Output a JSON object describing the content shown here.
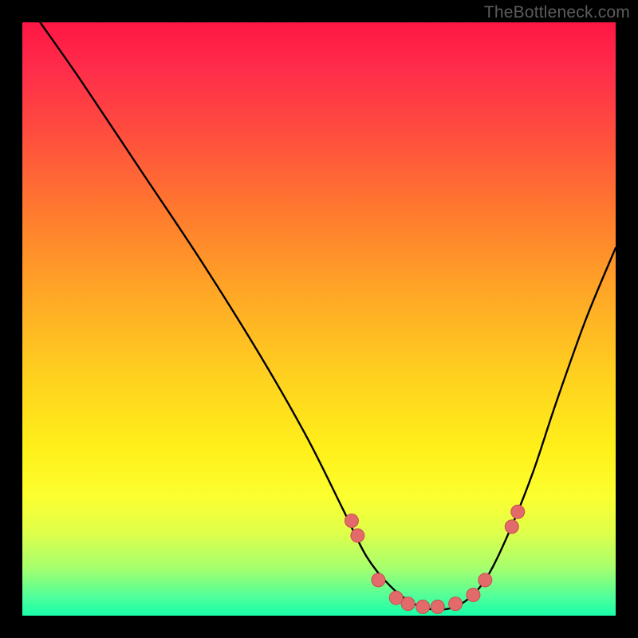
{
  "watermark": "TheBottleneck.com",
  "colors": {
    "frame": "#000000",
    "curve_stroke": "#000000",
    "marker_fill": "#e26a6a",
    "marker_stroke": "#c94f4f"
  },
  "chart_data": {
    "type": "line",
    "title": "",
    "xlabel": "",
    "ylabel": "",
    "xlim": [
      0,
      100
    ],
    "ylim": [
      0,
      100
    ],
    "grid": false,
    "legend": false,
    "series": [
      {
        "name": "bottleneck-curve",
        "x": [
          3,
          10,
          20,
          30,
          40,
          48,
          54,
          58,
          62,
          66,
          70,
          74,
          78,
          82,
          86,
          90,
          95,
          100
        ],
        "y": [
          100,
          90,
          75,
          60,
          44,
          30,
          18,
          10,
          5,
          2,
          1,
          2,
          6,
          14,
          24,
          36,
          50,
          62
        ]
      }
    ],
    "markers": {
      "name": "highlight-dots",
      "x": [
        55.5,
        56.5,
        60,
        63,
        65,
        67.5,
        70,
        73,
        76,
        78,
        82.5,
        83.5
      ],
      "y": [
        16,
        13.5,
        6,
        3,
        2,
        1.5,
        1.5,
        2,
        3.5,
        6,
        15,
        17.5
      ]
    }
  }
}
